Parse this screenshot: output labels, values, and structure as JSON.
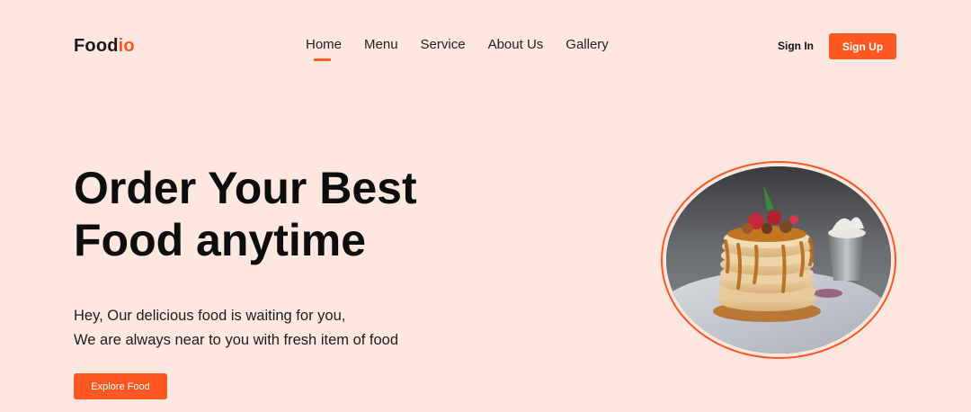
{
  "brand": {
    "name_main": "Food",
    "name_accent": "io",
    "accent_color": "#ff5722"
  },
  "nav": {
    "items": [
      {
        "label": "Home",
        "active": true
      },
      {
        "label": "Menu",
        "active": false
      },
      {
        "label": "Service",
        "active": false
      },
      {
        "label": "About Us",
        "active": false
      },
      {
        "label": "Gallery",
        "active": false
      }
    ]
  },
  "auth": {
    "signin_label": "Sign In",
    "signup_label": "Sign Up"
  },
  "hero": {
    "title_line1": "Order Your Best",
    "title_line2": "Food anytime",
    "subtitle_line1": "Hey, Our delicious food is waiting for you,",
    "subtitle_line2": "We are always near to you with fresh item of food",
    "cta_label": "Explore Food"
  },
  "image": {
    "subject": "stack of pancakes with fruit and syrup"
  },
  "colors": {
    "background": "#fde7de",
    "accent": "#ff5722",
    "text": "#0d0d0d"
  }
}
